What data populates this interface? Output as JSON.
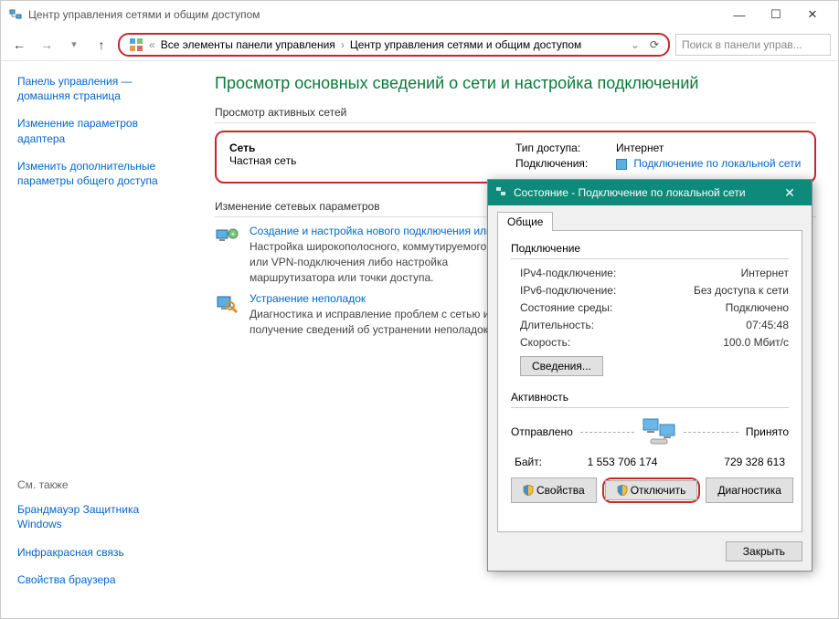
{
  "window": {
    "title": "Центр управления сетями и общим доступом"
  },
  "nav": {
    "back_icon": "←",
    "fwd_icon": "→",
    "up_icon": "↑",
    "breadcrumb_prefix": "«",
    "breadcrumb1": "Все элементы панели управления",
    "breadcrumb_sep": "›",
    "breadcrumb2": "Центр управления сетями и общим доступом",
    "search_placeholder": "Поиск в панели управ..."
  },
  "sidebar": {
    "items": [
      "Панель управления — домашняя страница",
      "Изменение параметров адаптера",
      "Изменить дополнительные параметры общего доступа"
    ],
    "see_also_label": "См. также",
    "see_also": [
      "Брандмауэр Защитника Windows",
      "Инфракрасная связь",
      "Свойства браузера"
    ]
  },
  "main": {
    "heading": "Просмотр основных сведений о сети и настройка подключений",
    "active_section": "Просмотр активных сетей",
    "network": {
      "name": "Сеть",
      "type": "Частная сеть",
      "access_label": "Тип доступа:",
      "access_value": "Интернет",
      "conn_label": "Подключения:",
      "conn_value": "Подключение по локальной сети"
    },
    "change_section": "Изменение сетевых параметров",
    "item1": {
      "link": "Создание и настройка нового подключения или сети",
      "desc": "Настройка широкополосного, коммутируемого или VPN-подключения либо настройка маршрутизатора или точки доступа."
    },
    "item2": {
      "link": "Устранение неполадок",
      "desc": "Диагностика и исправление проблем с сетью или получение сведений об устранении неполадок."
    }
  },
  "dialog": {
    "title": "Состояние - Подключение по локальной сети",
    "tab": "Общие",
    "connection_label": "Подключение",
    "rows": {
      "ipv4_label": "IPv4-подключение:",
      "ipv4_value": "Интернет",
      "ipv6_label": "IPv6-подключение:",
      "ipv6_value": "Без доступа к сети",
      "media_label": "Состояние среды:",
      "media_value": "Подключено",
      "duration_label": "Длительность:",
      "duration_value": "07:45:48",
      "speed_label": "Скорость:",
      "speed_value": "100.0 Мбит/с"
    },
    "details_btn": "Сведения...",
    "activity_label": "Активность",
    "sent_label": "Отправлено",
    "recv_label": "Принято",
    "bytes_label": "Байт:",
    "sent_bytes": "1 553 706 174",
    "recv_bytes": "729 328 613",
    "props_btn": "Свойства",
    "disable_btn": "Отключить",
    "diag_btn": "Диагностика",
    "close_btn": "Закрыть"
  }
}
